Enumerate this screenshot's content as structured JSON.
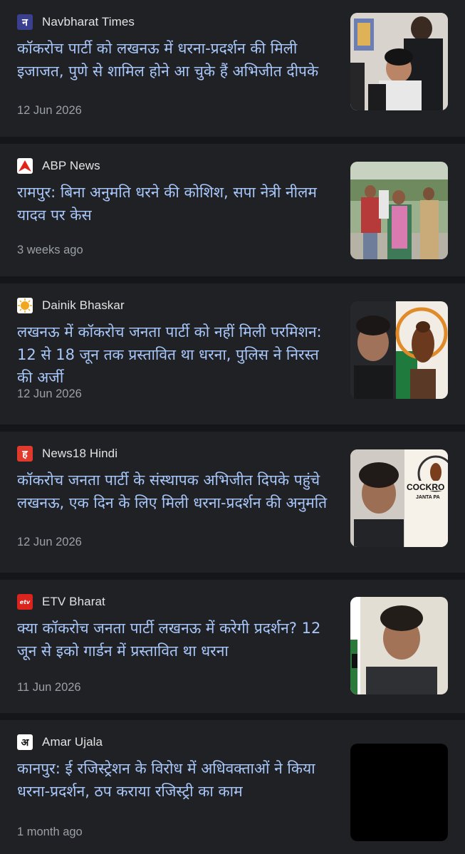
{
  "articles": [
    {
      "source": "Navbharat Times",
      "logo_text": "न",
      "headline": "कॉकरोच पार्टी को लखनऊ में धरना-प्रदर्शन की मिली इजाजत, पुणे से शामिल होने आ चुके हैं अभिजीत दीपके",
      "time": "12 Jun 2026",
      "thumbnail": "photo-men-crowd"
    },
    {
      "source": "ABP News",
      "logo_text": "",
      "headline": "रामपुर: बिना अनुमति धरने की कोशिश, सपा नेत्री नीलम यादव पर केस",
      "time": "3 weeks ago",
      "thumbnail": "photo-protest-walk"
    },
    {
      "source": "Dainik Bhaskar",
      "logo_text": "",
      "headline": "लखनऊ में कॉकरोच जनता पार्टी को नहीं मिली परमिशन: 12 से 18 जून तक प्रस्तावित था धरना, पुलिस ने निरस्त की अर्जी",
      "time": "12 Jun 2026",
      "thumbnail": "photo-man-and-cockroach-statue"
    },
    {
      "source": "News18 Hindi",
      "logo_text": "ह",
      "headline": "कॉकरोच जनता पार्टी के संस्थापक अभिजीत दिपके पहुंचे लखनऊ, एक दिन के लिए मिली धरना-प्रदर्शन की अनुमति",
      "time": "12 Jun 2026",
      "thumbnail": "photo-man-and-poster",
      "thumbnail_text": "COCKRO",
      "thumbnail_subtext": "JANTA PA"
    },
    {
      "source": "ETV Bharat",
      "logo_text": "etv",
      "headline": "क्या कॉकरोच जनता पार्टी लखनऊ में करेगी प्रदर्शन? 12 जून से इको गार्डन में प्रस्तावित था धरना",
      "time": "11 Jun 2026",
      "thumbnail": "photo-man-selfie"
    },
    {
      "source": "Amar Ujala",
      "logo_text": "अ",
      "headline": "कानपुर: ई रजिस्ट्रेशन के विरोध में अधिवक्ताओं ने किया धरना-प्रदर्शन, ठप कराया रजिस्ट्री का काम",
      "time": "1 month ago",
      "thumbnail": "photo-black-placeholder"
    }
  ],
  "colors": {
    "background": "#15161a",
    "card": "#202125",
    "headline": "#a8c7fa",
    "source": "#e3e3e3",
    "time": "#9aa0a6"
  }
}
